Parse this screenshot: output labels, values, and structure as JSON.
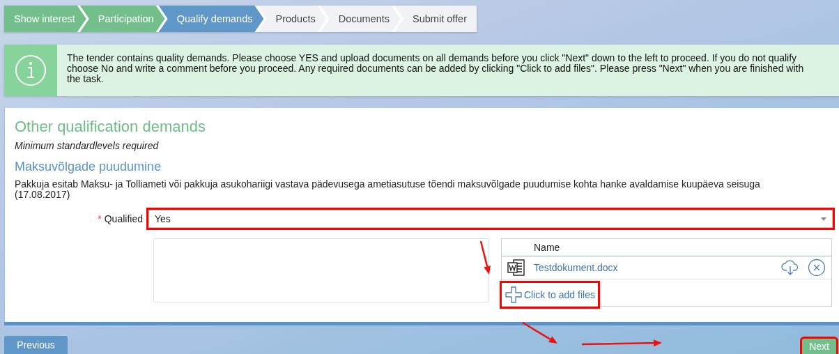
{
  "steps": [
    {
      "label": "Show interest",
      "kind": "done"
    },
    {
      "label": "Participation",
      "kind": "done"
    },
    {
      "label": "Qualify demands",
      "kind": "current"
    },
    {
      "label": "Products",
      "kind": "todo"
    },
    {
      "label": "Documents",
      "kind": "todo"
    },
    {
      "label": "Submit offer",
      "kind": "todo"
    }
  ],
  "info": {
    "text": "The tender contains quality demands. Please choose YES and upload documents on all demands before you click \"Next\" down to the left to proceed. If you do not qualify choose No and write a comment before you proceed. Any required documents can be added by clicking \"Click to add files\". Please press \"Next\" when you are finished with the task."
  },
  "section": {
    "title": "Other qualification demands",
    "subtitle": "Minimum standardlevels required"
  },
  "demand": {
    "title": "Maksuvõlgade puudumine",
    "description": "Pakkuja esitab Maksu- ja Tolliameti või pakkuja asukohariigi vastava pädevusega ametiasutuse tõendi maksuvõlgade puudumise kohta hanke avaldamise kuupäeva seisuga (17.08.2017)"
  },
  "qualified": {
    "required_mark": "*",
    "label": "Qualified",
    "value": "Yes",
    "highlighted": true
  },
  "files": {
    "columns": [
      "Name"
    ],
    "rows": [
      {
        "name": "Testdokument.docx"
      }
    ],
    "add_files": {
      "label": "Click to add files",
      "highlighted": true
    }
  },
  "footer": {
    "previous": {
      "label": "Previous",
      "highlighted": false
    },
    "next": {
      "label": "Next",
      "highlighted": true
    }
  }
}
